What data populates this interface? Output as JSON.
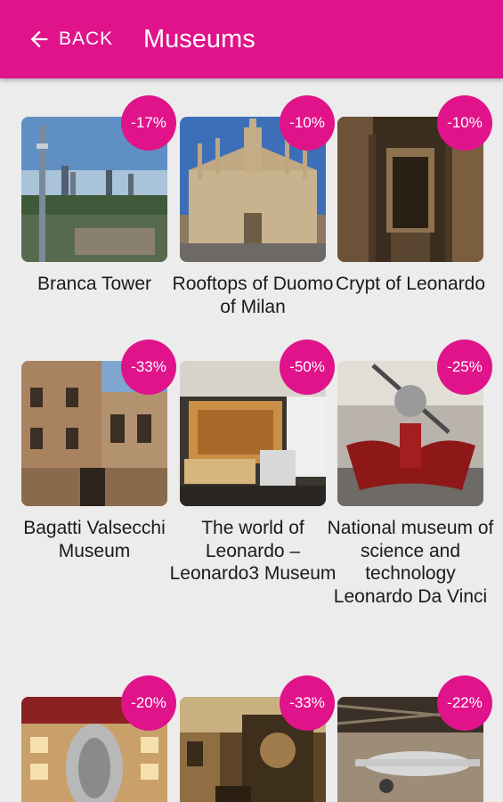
{
  "header": {
    "back_label": "BACK",
    "title": "Museums"
  },
  "colors": {
    "accent": "#e0138a",
    "background": "#ececec"
  },
  "museums": [
    {
      "name": "Branca Tower",
      "discount": "-17%"
    },
    {
      "name": "Rooftops of Duomo of Milan",
      "discount": "-10%"
    },
    {
      "name": "Crypt of Leonardo",
      "discount": "-10%"
    },
    {
      "name": "Bagatti Valsecchi Museum",
      "discount": "-33%"
    },
    {
      "name": "The world of Leonardo – Leonardo3 Museum",
      "discount": "-50%"
    },
    {
      "name": "National museum of science and technology Leonardo Da Vinci",
      "discount": "-25%"
    },
    {
      "name": "",
      "discount": "-20%"
    },
    {
      "name": "",
      "discount": "-33%"
    },
    {
      "name": "",
      "discount": "-22%"
    }
  ]
}
